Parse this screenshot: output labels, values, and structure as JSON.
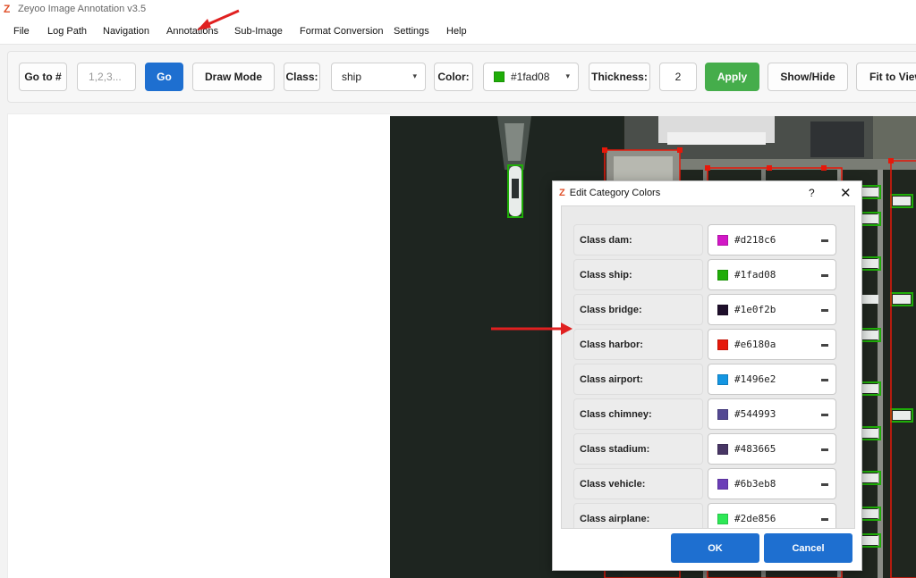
{
  "app": {
    "title": "Zeyoo Image Annotation v3.5",
    "logo_glyph": "Z",
    "accent": "#e0502a"
  },
  "menu": [
    "File",
    "Log Path",
    "Navigation",
    "Annotations",
    "Sub-Image",
    "Format Conversion",
    "Settings",
    "Help"
  ],
  "toolbar": {
    "goto_label": "Go to #",
    "goto_placeholder": "1,2,3...",
    "go_label": "Go",
    "draw_mode_label": "Draw Mode",
    "class_label": "Class:",
    "class_value": "ship",
    "color_label": "Color:",
    "color_value": "#1fad08",
    "thickness_label": "Thickness:",
    "thickness_value": "2",
    "apply_label": "Apply",
    "showhide_label": "Show/Hide",
    "fit_label": "Fit to View",
    "primary_color": "#1e6fd0",
    "apply_color": "#45ad4b"
  },
  "dialog": {
    "title": "Edit Category Colors",
    "help_glyph": "?",
    "close_glyph": "✕",
    "ok_label": "OK",
    "cancel_label": "Cancel",
    "categories": [
      {
        "label": "Class dam:",
        "color": "#d218c6"
      },
      {
        "label": "Class ship:",
        "color": "#1fad08"
      },
      {
        "label": "Class bridge:",
        "color": "#1e0f2b"
      },
      {
        "label": "Class harbor:",
        "color": "#e6180a"
      },
      {
        "label": "Class airport:",
        "color": "#1496e2"
      },
      {
        "label": "Class chimney:",
        "color": "#544993"
      },
      {
        "label": "Class stadium:",
        "color": "#483665"
      },
      {
        "label": "Class vehicle:",
        "color": "#6b3eb8"
      },
      {
        "label": "Class airplane:",
        "color": "#2de856"
      }
    ]
  },
  "annotation_arrow_color": "#e02020"
}
